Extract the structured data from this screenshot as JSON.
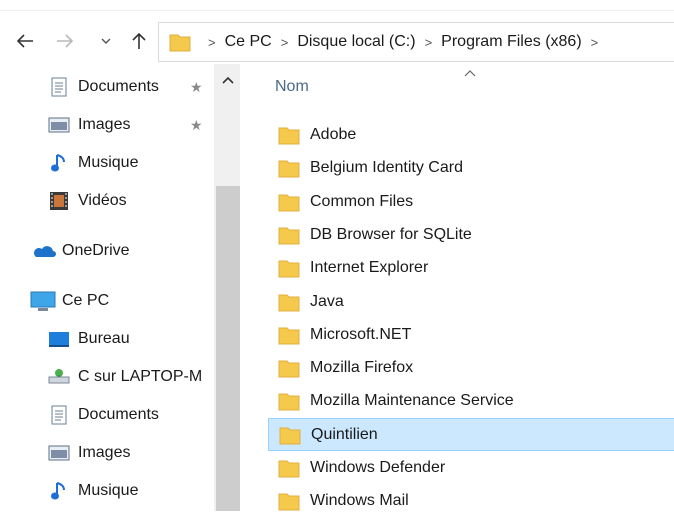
{
  "address": {
    "crumbs": [
      "Ce PC",
      "Disque local (C:)",
      "Program Files (x86)"
    ]
  },
  "nav": {
    "items": [
      {
        "label": "Documents",
        "icon": "documents-icon",
        "pinned": true
      },
      {
        "label": "Images",
        "icon": "images-icon",
        "pinned": true
      },
      {
        "label": "Musique",
        "icon": "music-icon",
        "pinned": false
      },
      {
        "label": "Vidéos",
        "icon": "videos-icon",
        "pinned": false
      },
      {
        "label": "OneDrive",
        "icon": "onedrive-icon",
        "pinned": false
      },
      {
        "label": "Ce PC",
        "icon": "computer-icon",
        "pinned": false
      },
      {
        "label": "Bureau",
        "icon": "desktop-icon",
        "pinned": false
      },
      {
        "label": "C sur LAPTOP-M",
        "icon": "network-drive-icon",
        "pinned": false
      },
      {
        "label": "Documents",
        "icon": "documents-icon",
        "pinned": false
      },
      {
        "label": "Images",
        "icon": "images-icon",
        "pinned": false
      },
      {
        "label": "Musique",
        "icon": "music-icon",
        "pinned": false
      }
    ]
  },
  "content": {
    "column_name": "Nom",
    "rows": [
      {
        "name": "Adobe"
      },
      {
        "name": "Belgium Identity Card"
      },
      {
        "name": "Common Files"
      },
      {
        "name": "DB Browser for SQLite"
      },
      {
        "name": "Internet Explorer"
      },
      {
        "name": "Java"
      },
      {
        "name": "Microsoft.NET"
      },
      {
        "name": "Mozilla Firefox"
      },
      {
        "name": "Mozilla Maintenance Service"
      },
      {
        "name": "Quintilien",
        "selected": true
      },
      {
        "name": "Windows Defender"
      },
      {
        "name": "Windows Mail"
      }
    ]
  },
  "colors": {
    "selection_bg": "#cce8ff",
    "selection_border": "#99d1ff",
    "folder": "#f5c94b",
    "header_text": "#4d6a8a"
  }
}
